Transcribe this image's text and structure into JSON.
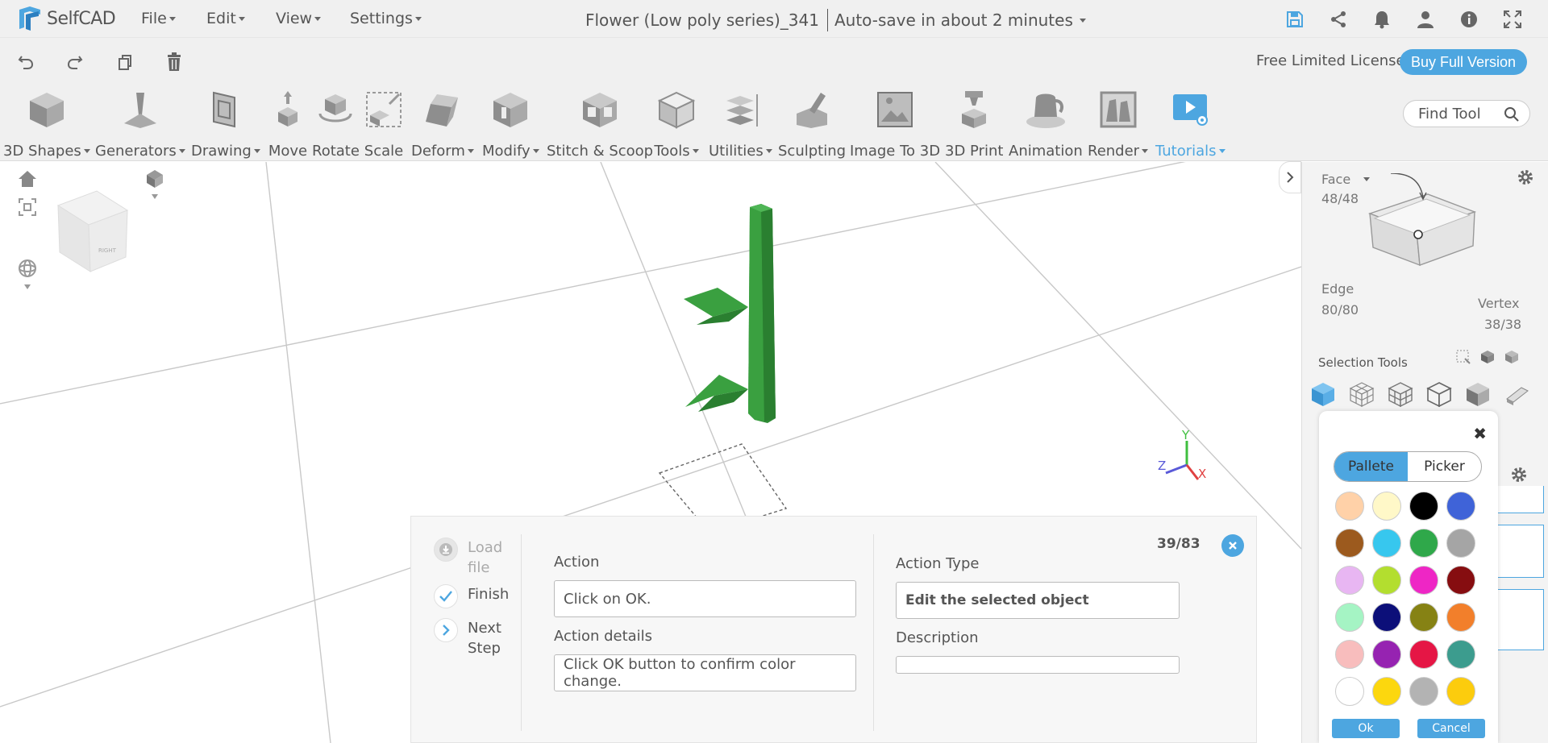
{
  "app": {
    "logo_text": "SelfCAD",
    "menus": [
      "File",
      "Edit",
      "View",
      "Settings"
    ],
    "document_title": "Flower (Low poly series)_341",
    "autosave_text": "Auto-save in about 2 minutes"
  },
  "license": {
    "text": "Free Limited License",
    "buy_label": "Buy Full Version"
  },
  "toolbar": {
    "tools": [
      {
        "label": "3D Shapes",
        "dropdown": true
      },
      {
        "label": "Generators",
        "dropdown": true
      },
      {
        "label": "Drawing",
        "dropdown": true
      },
      {
        "label": "Move",
        "dropdown": false
      },
      {
        "label": "Rotate",
        "dropdown": false
      },
      {
        "label": "Scale",
        "dropdown": false
      },
      {
        "label": "Deform",
        "dropdown": true
      },
      {
        "label": "Modify",
        "dropdown": true
      },
      {
        "label": "Stitch & Scoop",
        "dropdown": false
      },
      {
        "label": "Tools",
        "dropdown": true
      },
      {
        "label": "Utilities",
        "dropdown": true
      },
      {
        "label": "Sculpting",
        "dropdown": false
      },
      {
        "label": "Image To 3D",
        "dropdown": false
      },
      {
        "label": "3D Print",
        "dropdown": false
      },
      {
        "label": "Animation",
        "dropdown": false
      },
      {
        "label": "Render",
        "dropdown": true
      },
      {
        "label": "Tutorials",
        "dropdown": true
      }
    ],
    "find_placeholder": "Find Tool"
  },
  "viewport": {
    "cube_face_label": "RIGHT",
    "axes": {
      "x": "X",
      "y": "Y",
      "z": "Z"
    }
  },
  "right_panel": {
    "mode": "Face",
    "face_count": "48/48",
    "edge_label": "Edge",
    "edge_count": "80/80",
    "vertex_label": "Vertex",
    "vertex_count": "38/38",
    "selection_tools_label": "Selection Tools"
  },
  "palette": {
    "tab_palette": "Pallete",
    "tab_picker": "Picker",
    "ok_label": "Ok",
    "cancel_label": "Cancel",
    "colors": [
      "#ffd1a8",
      "#fff8c8",
      "#000000",
      "#3f63d8",
      "#9c5a1e",
      "#37c7ee",
      "#2fa84a",
      "#a5a5a5",
      "#e8b6f2",
      "#b3de2f",
      "#ee26c5",
      "#860d10",
      "#a5f4c4",
      "#0c0f79",
      "#868214",
      "#f27f2b",
      "#f8bdbd",
      "#9623b1",
      "#e51645",
      "#3c9c8e",
      "#ffffff",
      "#fcd70e",
      "#b3b3b3",
      "#fccc0d"
    ]
  },
  "tutorial": {
    "steps": [
      {
        "label_line1": "Load",
        "label_line2": "file",
        "state": "done"
      },
      {
        "label_line1": "Finish",
        "label_line2": "",
        "state": "check"
      },
      {
        "label_line1": "Next",
        "label_line2": "Step",
        "state": "next"
      }
    ],
    "counter": "39/83",
    "action_label": "Action",
    "action_value": "Click on OK.",
    "action_details_label": "Action details",
    "action_details_value": "Click OK button to confirm color change.",
    "action_type_label": "Action Type",
    "action_type_value": "Edit the selected object",
    "description_label": "Description",
    "description_value": ""
  },
  "colors": {
    "accent": "#4da6e0",
    "plant_green": "#3a8f3a",
    "toolbar_bg": "#f0f0f0"
  }
}
